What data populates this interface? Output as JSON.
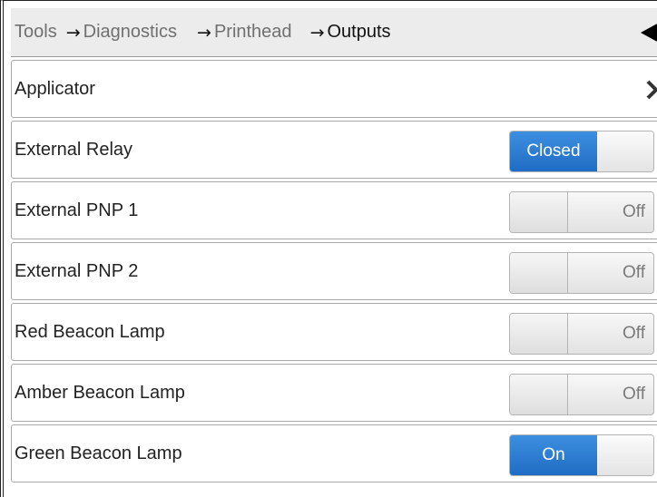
{
  "breadcrumb": [
    {
      "label": "Tools",
      "current": false
    },
    {
      "label": "Diagnostics",
      "current": false
    },
    {
      "label": "Printhead",
      "current": false
    },
    {
      "label": "Outputs",
      "current": true
    }
  ],
  "breadcrumb_arrow": "→",
  "back_icon": "back-triangle-icon",
  "rows": [
    {
      "label": "Applicator",
      "kind": "submenu",
      "icon": "chevron-right-icon"
    },
    {
      "label": "External Relay",
      "kind": "toggle",
      "on": true,
      "state_label": "Closed"
    },
    {
      "label": "External PNP 1",
      "kind": "toggle",
      "on": false,
      "state_label": "Off"
    },
    {
      "label": "External PNP 2",
      "kind": "toggle",
      "on": false,
      "state_label": "Off"
    },
    {
      "label": "Red Beacon Lamp",
      "kind": "toggle",
      "on": false,
      "state_label": "Off"
    },
    {
      "label": "Amber Beacon Lamp",
      "kind": "toggle",
      "on": false,
      "state_label": "Off"
    },
    {
      "label": "Green Beacon Lamp",
      "kind": "toggle",
      "on": true,
      "state_label": "On"
    }
  ],
  "colors": {
    "accent": "#2a7ad2",
    "header_bg": "#ececec",
    "text": "#222222",
    "muted_text": "#707070"
  }
}
